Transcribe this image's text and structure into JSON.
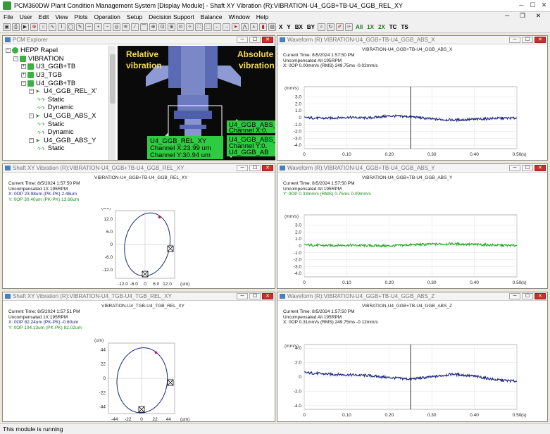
{
  "app": {
    "title": "PCM360DW Plant Condition Management System [Display Module] - Shaft XY Vibration (R):VIBRATION-U4_GGB+TB-U4_GGB_REL_XY"
  },
  "menu": [
    "File",
    "User",
    "Edit",
    "View",
    "Plots",
    "Operation",
    "Setup",
    "Decision Support",
    "Balance",
    "Window",
    "Help"
  ],
  "toolbar_text": [
    "X",
    "Y",
    "BX",
    "BY",
    "All",
    "1X",
    "2X",
    "TC",
    "TS"
  ],
  "explorer": {
    "title": "PCM Explorer",
    "tree": [
      {
        "label": "HEPP Rapel",
        "level": 0,
        "kind": "root"
      },
      {
        "label": "VIBRATION",
        "level": 1,
        "kind": "group"
      },
      {
        "label": "U3_GGB+TB",
        "level": 2,
        "kind": "node"
      },
      {
        "label": "U3_TGB",
        "level": 2,
        "kind": "node"
      },
      {
        "label": "U4_GGB+TB",
        "level": 2,
        "kind": "node"
      },
      {
        "label": "U4_GGB_REL_X'",
        "level": 3,
        "kind": "sensor"
      },
      {
        "label": "Static",
        "level": 4,
        "kind": "leaf"
      },
      {
        "label": "Dynamic",
        "level": 4,
        "kind": "leaf"
      },
      {
        "label": "U4_GGB_ABS_X",
        "level": 3,
        "kind": "sensor"
      },
      {
        "label": "Static",
        "level": 4,
        "kind": "leaf"
      },
      {
        "label": "Dynamic",
        "level": 4,
        "kind": "leaf"
      },
      {
        "label": "U4_GGB_ABS_Y",
        "level": 3,
        "kind": "sensor"
      },
      {
        "label": "Static",
        "level": 4,
        "kind": "leaf"
      }
    ]
  },
  "overlay": {
    "relative": "Relative\nvibration",
    "absolute": "Absolute\nvibration",
    "rel_box": {
      "title": "U4_GGB_REL_XY",
      "line1": "Channel X:23.99 um",
      "line2": "Channel Y:30.94 um"
    },
    "abs_box1": {
      "title": "U4_GGB_ABS_",
      "line1": "Channel X:0."
    },
    "abs_box2": {
      "title": "U4_GGB_ABS_",
      "line1": "Channel Y:0.",
      "line2": "U4_GGB_AB"
    }
  },
  "w_abs_x": {
    "title": "Waveform (R):VIBRATION-U4_GGB+TB-U4_GGB_ABS_X",
    "chart_title": "VIBRATION-U4_GGB+TB-U4_GGB_ABS_X",
    "info1": "Current Time: 8/5/2024 1:57:50 PM",
    "info2": "Uncompensated    All    195RPM",
    "info3": "X: 0OP  0.00mm/s (RMS)   249.75ms   -0.02mm/s"
  },
  "w_abs_y": {
    "title": "Waveform (R):VIBRATION-U4_GGB+TB-U4_GGB_ABS_Y",
    "chart_title": "VIBRATION-U4_GGB+TB-U4_GGB_ABS_Y",
    "info1": "Current Time: 8/5/2024 1:57:50 PM",
    "info2": "Uncompensated    All    195RPM",
    "info3": "Y: 0OP  0.33mm/s (RMS)    0.75ms    0.09mm/s"
  },
  "w_abs_z": {
    "title": "Waveform (R):VIBRATION-U4_GGB+TB-U4_GGB_ABS_Z",
    "chart_title": "VIBRATION-U4_GGB+TB-U4_GGB_ABS_Z",
    "info1": "Current Time: 8/5/2024 1:57:50 PM",
    "info2": "Uncompensated    All    195RPM",
    "info3": "X: 0OP  0.31mm/s (RMS)   249.75ms   -0.12mm/s"
  },
  "s_ggb": {
    "title": "Shaft XY Vibration (R):VIBRATION-U4_GGB+TB-U4_GGB_REL_XY",
    "chart_title": "VIBRATION-U4_GGB+TB-U4_GGB_REL_XY",
    "info1": "Current Time: 8/5/2024 1:57:50 PM",
    "info2": "Uncompensated     1X    195RPM",
    "info3": "X: 0OP  23.98um  (PK-PK)   2.48um",
    "info4": "Y: 0OP  30.40um  (PK-PK)   13.66um"
  },
  "s_tgb": {
    "title": "Shaft XY Vibration (R):VIBRATION-U4_TGB-U4_TGB_REL_XY",
    "chart_title": "VIBRATION-U4_TGB-U4_TGB_REL_XY",
    "info1": "Current Time: 8/5/2024 1:57:51 PM",
    "info2": "Uncompensated     1X    195RPM",
    "info3": "X: 0OP  82.24um  (PK-PK)   -0.60um",
    "info4": "Y: 0OP  104.13um  (PK-PK)   82.02um"
  },
  "status": "This module is running",
  "chart_data": [
    {
      "type": "line",
      "title": "VIBRATION-U4_GGB+TB-U4_GGB_ABS_X",
      "ylabel": "(mm/s)",
      "xlabel": "(s)",
      "x": [
        0,
        0.05,
        0.1,
        0.15,
        0.2,
        0.25,
        0.3,
        0.35,
        0.4,
        0.45,
        0.5
      ],
      "series": [
        {
          "values": [
            0.0,
            -0.1,
            0.05,
            -0.05,
            0.25,
            0.15,
            -0.2,
            -0.35,
            -0.25,
            -0.1,
            -0.05
          ],
          "color": "#1a237e"
        }
      ],
      "ylim": [
        -4.5,
        4.5
      ],
      "yticks": [
        3.0,
        2.0,
        1.0,
        0,
        -1.0,
        -2.0,
        -3.0,
        -4.0
      ],
      "xticks": [
        "0",
        "0.10",
        "0.20",
        "0.30",
        "0.40",
        "0.50"
      ],
      "cursor": 0.25
    },
    {
      "type": "line",
      "title": "VIBRATION-U4_GGB+TB-U4_GGB_ABS_Y",
      "ylabel": "(mm/s)",
      "xlabel": "(s)",
      "x": [
        0,
        0.05,
        0.1,
        0.15,
        0.2,
        0.25,
        0.3,
        0.35,
        0.4,
        0.45,
        0.5
      ],
      "series": [
        {
          "values": [
            0.15,
            0.05,
            0.1,
            0.05,
            0.0,
            0.15,
            0.25,
            0.3,
            0.2,
            0.1,
            0.05
          ],
          "color": "#22aa22"
        }
      ],
      "ylim": [
        -4.5,
        4.5
      ],
      "yticks": [
        3.0,
        2.0,
        1.0,
        0,
        -1.0,
        -2.0,
        -3.0,
        -4.0
      ],
      "xticks": [
        "0",
        "0.10",
        "0.20",
        "0.30",
        "0.40",
        "0.50"
      ],
      "cursor": null
    },
    {
      "type": "line",
      "title": "VIBRATION-U4_GGB+TB-U4_GGB_ABS_Z",
      "ylabel": "(mm/s)",
      "xlabel": "(s)",
      "x": [
        0,
        0.05,
        0.1,
        0.15,
        0.2,
        0.25,
        0.3,
        0.35,
        0.4,
        0.45,
        0.5
      ],
      "series": [
        {
          "values": [
            0.6,
            0.4,
            0.3,
            0.2,
            -0.1,
            -0.3,
            0.0,
            0.4,
            0.1,
            -0.4,
            -0.6
          ],
          "color": "#1a237e"
        }
      ],
      "ylim": [
        -4.5,
        4.5
      ],
      "yticks": [
        4.0,
        2.0,
        0,
        -2.0,
        -4.0
      ],
      "xticks": [
        "0",
        "0.10",
        "0.20",
        "0.30",
        "0.40",
        "0.50"
      ],
      "cursor": 0.25
    },
    {
      "type": "scatter",
      "title": "VIBRATION-U4_GGB+TB-U4_GGB_REL_XY",
      "xlabel": "(um)",
      "ylabel": "(um)",
      "xlim": [
        -16,
        16
      ],
      "ylim": [
        -16,
        16
      ],
      "xticks": [
        -12.0,
        -6.0,
        0,
        6.0,
        12.0
      ],
      "yticks": [
        12.0,
        6.0,
        0,
        -6.0,
        -12.0
      ],
      "orbit": {
        "cx": 1.2,
        "cy": 0,
        "rx": 12,
        "ry": 15.2,
        "rot": -18
      }
    },
    {
      "type": "scatter",
      "title": "VIBRATION-U4_TGB-U4_TGB_REL_XY",
      "xlabel": "(um)",
      "ylabel": "(um)",
      "xlim": [
        -54,
        54
      ],
      "ylim": [
        -54,
        54
      ],
      "xticks": [
        -44,
        -22,
        0,
        22,
        44
      ],
      "yticks": [
        44,
        22,
        0,
        -22,
        -44
      ],
      "orbit": {
        "cx": 1,
        "cy": -3,
        "rx": 41,
        "ry": 50,
        "rot": -8
      }
    }
  ]
}
